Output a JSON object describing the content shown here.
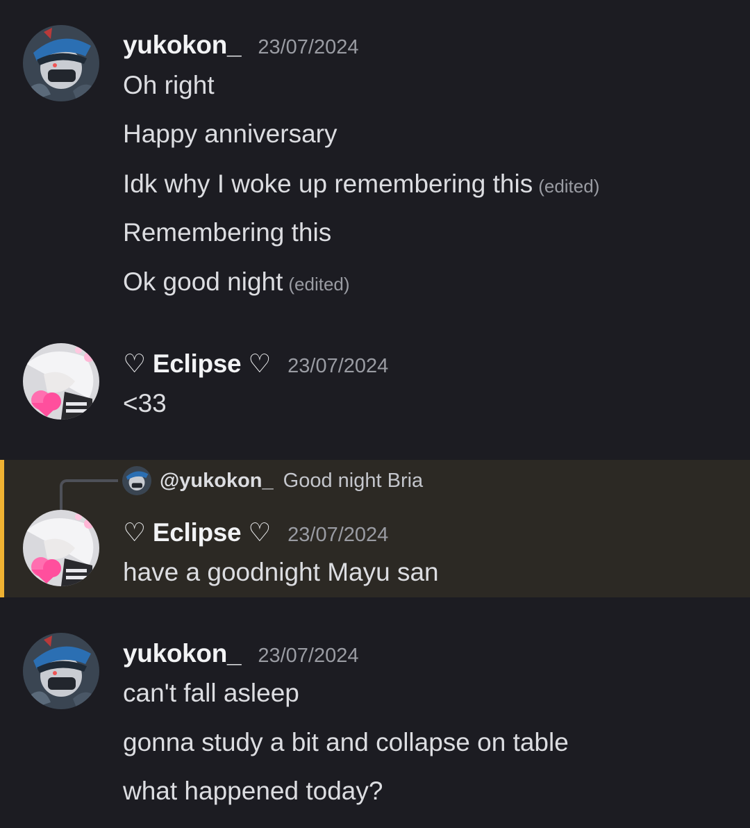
{
  "messages": [
    {
      "author": "yukokon_",
      "timestamp": "23/07/2024",
      "lines": [
        {
          "text": "Oh right",
          "edited": ""
        },
        {
          "text": "Happy anniversary",
          "edited": ""
        },
        {
          "text": "Idk why I woke up remembering this",
          "edited": "(edited)"
        },
        {
          "text": "Remembering this",
          "edited": ""
        },
        {
          "text": "Ok good night",
          "edited": "(edited)"
        }
      ]
    },
    {
      "author": "♡ Eclipse ♡",
      "timestamp": "23/07/2024",
      "lines": [
        {
          "text": "<33"
        }
      ]
    },
    {
      "reply": {
        "mention": "@yukokon_",
        "text": "Good night Bria"
      },
      "author": "♡ Eclipse ♡",
      "timestamp": "23/07/2024",
      "lines": [
        {
          "text": "have a goodnight Mayu san"
        }
      ]
    },
    {
      "author": "yukokon_",
      "timestamp": "23/07/2024",
      "lines": [
        {
          "text": "can't fall asleep"
        },
        {
          "text": "gonna study a bit and collapse on table"
        },
        {
          "text": "what happened today?"
        }
      ]
    }
  ],
  "colors": {
    "background": "#1c1c22",
    "highlight": "#2c2924",
    "highlight_bar": "#f0b232",
    "username": "#f2f3f5",
    "text": "#dcdde1",
    "muted": "#9a9ca3"
  },
  "icons": {
    "avatar_yukokon": "masked-character-avatar-icon",
    "avatar_eclipse": "white-haired-character-with-hearts-avatar-icon"
  }
}
